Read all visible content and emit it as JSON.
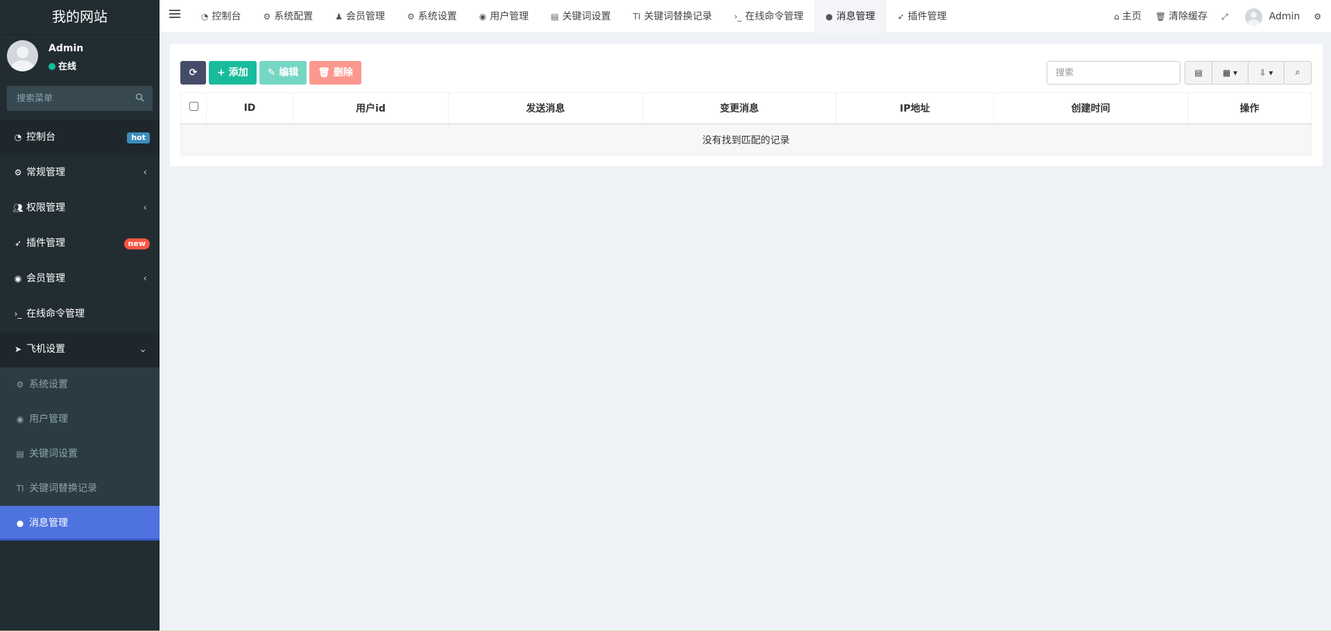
{
  "sidebar": {
    "logo": "我的网站",
    "user": {
      "name": "Admin",
      "status": "在线"
    },
    "search_placeholder": "搜索菜单",
    "menu": [
      {
        "label": "控制台",
        "icon": "dashboard-icon",
        "badge": "hot"
      },
      {
        "label": "常规管理",
        "icon": "cogs-icon"
      },
      {
        "label": "权限管理",
        "icon": "users-icon"
      },
      {
        "label": "插件管理",
        "icon": "rocket-icon",
        "badge": "new"
      },
      {
        "label": "会员管理",
        "icon": "user-circle-icon"
      },
      {
        "label": "在线命令管理",
        "icon": "terminal-icon"
      },
      {
        "label": "飞机设置",
        "icon": "telegram-icon",
        "expanded": true
      }
    ],
    "submenu": [
      {
        "label": "系统设置",
        "icon": "gear-icon"
      },
      {
        "label": "用户管理",
        "icon": "user-circle-icon"
      },
      {
        "label": "关键词设置",
        "icon": "file-icon"
      },
      {
        "label": "关键词替换记录",
        "icon": "text-height-icon"
      },
      {
        "label": "消息管理",
        "icon": "comment-icon",
        "active": true
      }
    ]
  },
  "navbar": {
    "tabs": [
      {
        "label": "控制台",
        "icon": "dashboard-icon"
      },
      {
        "label": "系统配置",
        "icon": "gear-icon"
      },
      {
        "label": "会员管理",
        "icon": "user-icon"
      },
      {
        "label": "系统设置",
        "icon": "gear-icon"
      },
      {
        "label": "用户管理",
        "icon": "user-circle-icon"
      },
      {
        "label": "关键词设置",
        "icon": "file-icon"
      },
      {
        "label": "关键词替换记录",
        "icon": "text-height-icon"
      },
      {
        "label": "在线命令管理",
        "icon": "terminal-icon"
      },
      {
        "label": "消息管理",
        "icon": "comment-icon",
        "active": true
      },
      {
        "label": "插件管理",
        "icon": "rocket-icon"
      }
    ],
    "right": {
      "home": "主页",
      "clear_cache": "清除缓存",
      "user": "Admin"
    }
  },
  "toolbar": {
    "add": "添加",
    "edit": "编辑",
    "delete": "删除",
    "search_placeholder": "搜索"
  },
  "table": {
    "columns": [
      "ID",
      "用户id",
      "发送消息",
      "变更消息",
      "IP地址",
      "创建时间",
      "操作"
    ],
    "empty_text": "没有找到匹配的记录"
  },
  "colors": {
    "sidebar_bg": "#222d32",
    "active_item": "#4e73df",
    "success": "#18bc9c",
    "danger": "#f75444",
    "primary_dark": "#444c69"
  }
}
